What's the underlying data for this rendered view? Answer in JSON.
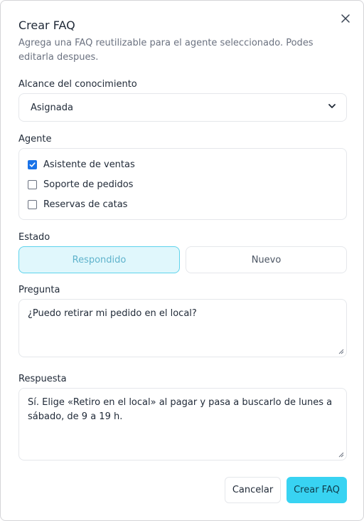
{
  "dialog": {
    "title": "Crear FAQ",
    "description": "Agrega una FAQ reutilizable para el agente seleccionado. Podes editarla despues."
  },
  "scope": {
    "label": "Alcance del conocimiento",
    "selected": "Asignada"
  },
  "agent": {
    "label": "Agente",
    "options": [
      {
        "label": "Asistente de ventas",
        "checked": true
      },
      {
        "label": "Soporte de pedidos",
        "checked": false
      },
      {
        "label": "Reservas de catas",
        "checked": false
      }
    ]
  },
  "status": {
    "label": "Estado",
    "options": [
      "Respondido",
      "Nuevo"
    ],
    "selected": "Respondido"
  },
  "question": {
    "label": "Pregunta",
    "value": "¿Puedo retirar mi pedido en el local?"
  },
  "answer": {
    "label": "Respuesta",
    "value": "Sí. Elige «Retiro en el local» al pagar y pasa a buscarlo de lunes a sábado, de 9 a 19 h."
  },
  "actions": {
    "cancel": "Cancelar",
    "create": "Crear FAQ"
  },
  "colors": {
    "accent": "#38d3f2",
    "accent_soft": "#e0f7fc",
    "checkbox": "#1a73e8"
  },
  "icons": {
    "close": "close-icon",
    "select_arrow": "chevron-down-icon",
    "check": "check-icon",
    "resize": "resize-grip-icon"
  }
}
